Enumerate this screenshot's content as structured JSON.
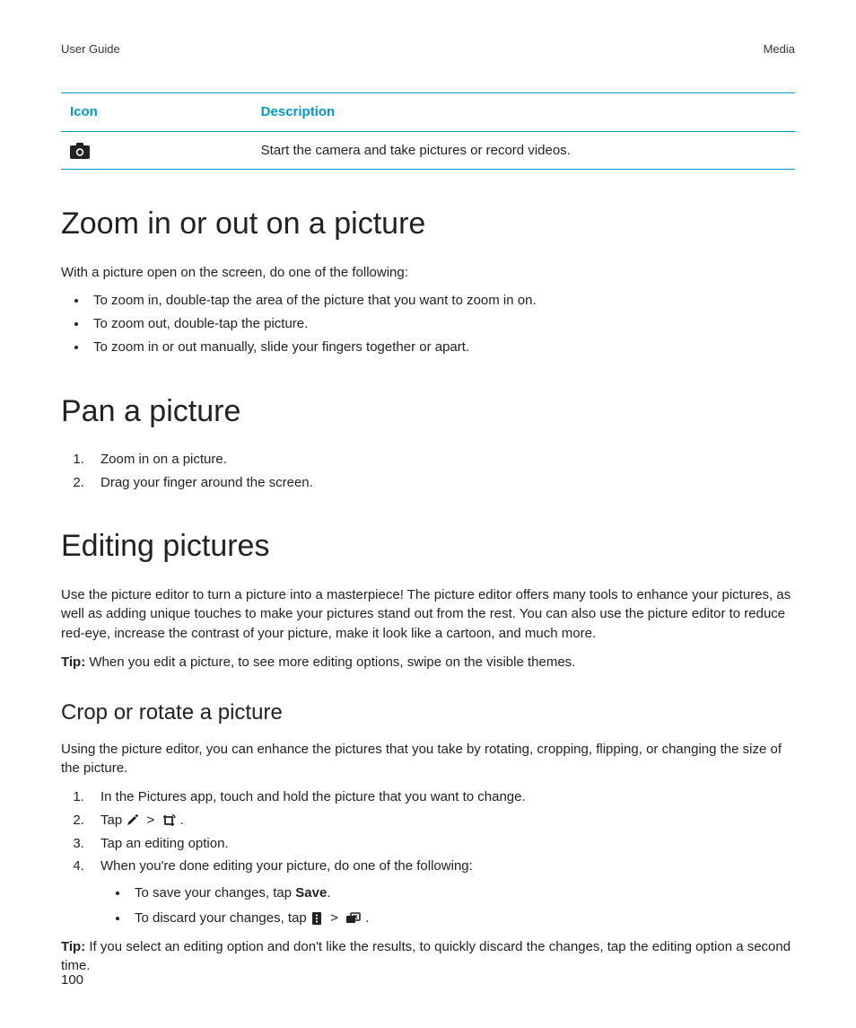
{
  "header": {
    "left": "User Guide",
    "right": "Media"
  },
  "table": {
    "headers": {
      "icon": "Icon",
      "desc": "Description"
    },
    "rows": [
      {
        "icon_name": "camera-icon",
        "desc": "Start the camera and take pictures or record videos."
      }
    ]
  },
  "sections": {
    "zoom": {
      "title": "Zoom in or out on a picture",
      "intro": "With a picture open on the screen, do one of the following:",
      "bullets": [
        "To zoom in, double-tap the area of the picture that you want to zoom in on.",
        "To zoom out, double-tap the picture.",
        "To zoom in or out manually, slide your fingers together or apart."
      ]
    },
    "pan": {
      "title": "Pan a picture",
      "steps": [
        "Zoom in on a picture.",
        "Drag your finger around the screen."
      ]
    },
    "edit": {
      "title": "Editing pictures",
      "intro": "Use the picture editor to turn a picture into a masterpiece! The picture editor offers many tools to enhance your pictures, as well as adding unique touches to make your pictures stand out from the rest. You can also use the picture editor to reduce red-eye, increase the contrast of your picture, make it look like a cartoon, and much more.",
      "tip_label": "Tip:",
      "tip": " When you edit a picture, to see more editing options, swipe on the visible themes.",
      "crop": {
        "title": "Crop or rotate a picture",
        "intro": "Using the picture editor, you can enhance the pictures that you take by rotating, cropping, flipping, or changing the size of the picture.",
        "steps": {
          "s1": "In the Pictures app, touch and hold the picture that you want to change.",
          "s2_before": "Tap ",
          "s2_gt": ">",
          "s2_after": ".",
          "s3": "Tap an editing option.",
          "s4": "When you're done editing your picture, do one of the following:",
          "s4_sub": {
            "a_before": "To save your changes, tap ",
            "a_save": "Save",
            "a_after": ".",
            "b_before": "To discard your changes, tap ",
            "b_gt": ">",
            "b_after": "."
          }
        },
        "tip_label": "Tip:",
        "tip": " If you select an editing option and don't like the results, to quickly discard the changes, tap the editing option a second time."
      }
    }
  },
  "page_number": "100"
}
